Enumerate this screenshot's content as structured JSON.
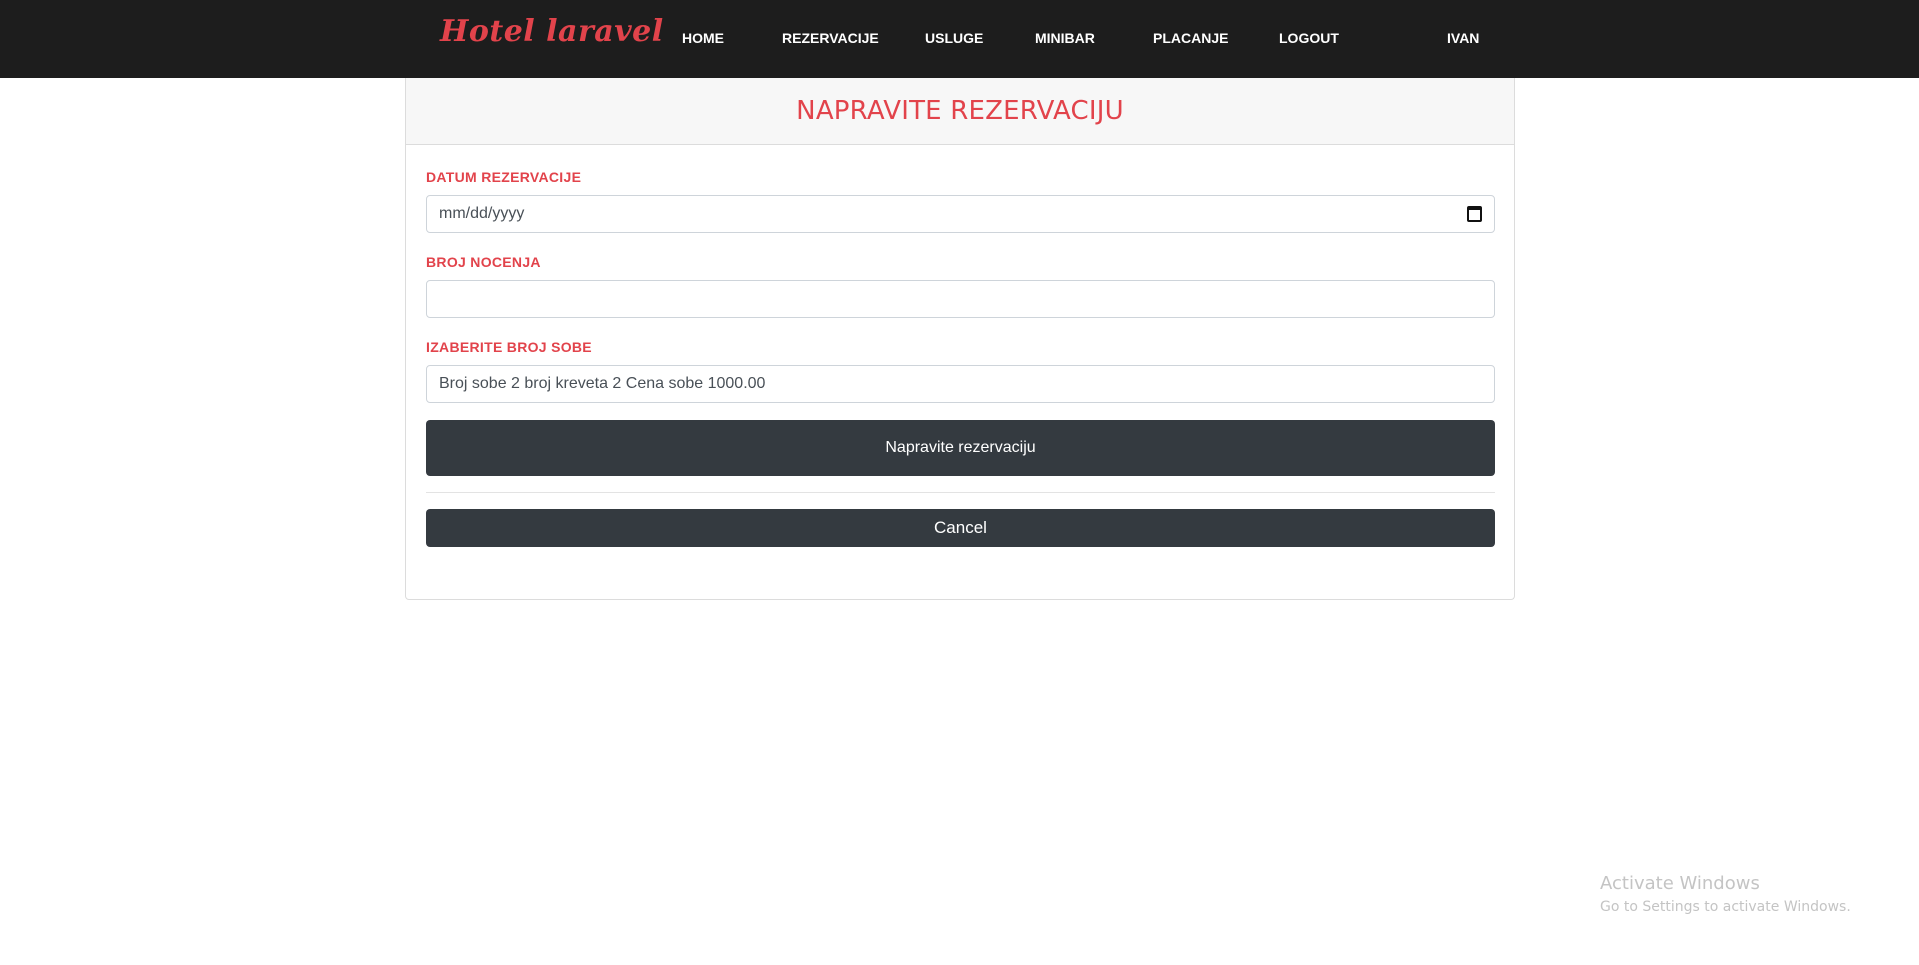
{
  "navbar": {
    "brand": "Hotel laravel",
    "links": [
      "HOME",
      "REZERVACIJE",
      "USLUGE",
      "MINIBAR",
      "PLACANJE",
      "LOGOUT"
    ],
    "user": "IVAN"
  },
  "form": {
    "title": "NAPRAVITE REZERVACIJU",
    "date_label": "DATUM REZERVACIJE",
    "date_placeholder": "mm/dd/yyyy",
    "nights_label": "BROJ NOCENJA",
    "nights_value": "",
    "room_label": "IZABERITE BROJ SOBE",
    "room_selected": "Broj sobe 2 broj kreveta 2 Cena sobe 1000.00",
    "submit_label": "Napravite rezervaciju",
    "cancel_label": "Cancel"
  },
  "watermark": {
    "title": "Activate Windows",
    "subtitle": "Go to Settings to activate Windows."
  },
  "colors": {
    "accent": "#e2434b",
    "navbar_bg": "#1d1d1d",
    "button_bg": "#343a40"
  }
}
